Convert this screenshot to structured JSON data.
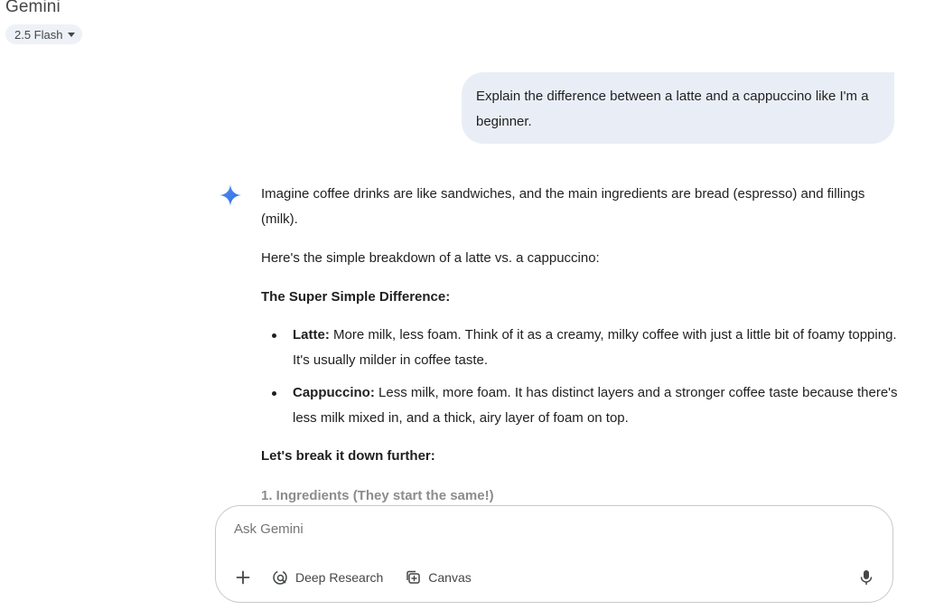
{
  "header": {
    "app_title": "Gemini",
    "model_selector": {
      "label": "2.5 Flash",
      "icon": "caret-down-icon"
    }
  },
  "conversation": {
    "user_message": "Explain the difference between a latte and a cappuccino like I'm a beginner.",
    "response": {
      "icon": "gemini-spark-icon",
      "intro": "Imagine coffee drinks are like sandwiches, and the main ingredients are bread (espresso) and fillings (milk).",
      "lead": "Here's the simple breakdown of a latte vs. a cappuccino:",
      "section_heading": "The Super Simple Difference:",
      "bullets": [
        {
          "term": "Latte:",
          "text": " More milk, less foam. Think of it as a creamy, milky coffee with just a little bit of foamy topping. It's usually milder in coffee taste."
        },
        {
          "term": "Cappuccino:",
          "text": " Less milk, more foam. It has distinct layers and a stronger coffee taste because there's less milk mixed in, and a thick, airy layer of foam on top."
        }
      ],
      "next_heading": "Let's break it down further:",
      "subheading": "1. Ingredients (They start the same!)"
    }
  },
  "composer": {
    "placeholder": "Ask Gemini",
    "tools": {
      "add_icon": "plus-icon",
      "deep_research_label": "Deep Research",
      "canvas_label": "Canvas"
    },
    "mic_icon": "microphone-icon"
  },
  "colors": {
    "user_bubble": "#e9eef6",
    "spark_blue": "#4285f4",
    "chip_bg": "#eef1f7"
  }
}
